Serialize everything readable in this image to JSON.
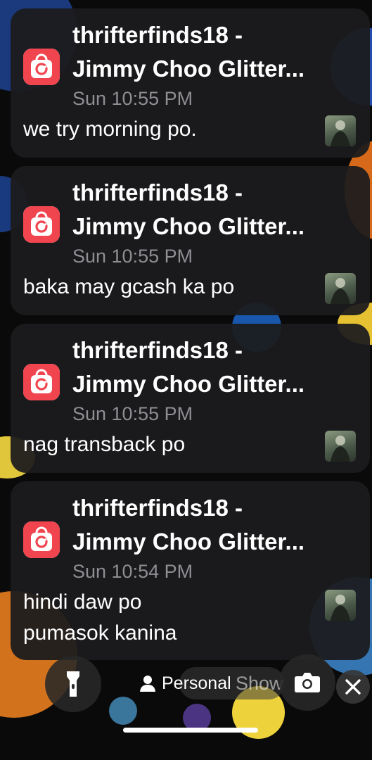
{
  "notifications": [
    {
      "title_line1": "thrifterfinds18 -",
      "title_line2": "Jimmy Choo Glitter...",
      "time": "Sun 10:55 PM",
      "message_line1": "we try morning po.",
      "message_line2": ""
    },
    {
      "title_line1": "thrifterfinds18 -",
      "title_line2": "Jimmy Choo Glitter...",
      "time": "Sun 10:55 PM",
      "message_line1": "baka may gcash ka po",
      "message_line2": ""
    },
    {
      "title_line1": "thrifterfinds18 -",
      "title_line2": "Jimmy Choo Glitter...",
      "time": "Sun 10:55 PM",
      "message_line1": "nag transback po",
      "message_line2": ""
    },
    {
      "title_line1": "thrifterfinds18 -",
      "title_line2": "Jimmy Choo Glitter...",
      "time": "Sun 10:54 PM",
      "message_line1": "hindi daw po",
      "message_line2": "pumasok kanina"
    }
  ],
  "lockscreen": {
    "focus_label": "Personal",
    "show_label": "Show",
    "flashlight_icon": "flashlight-icon",
    "camera_icon": "camera-icon",
    "close_icon": "close-icon",
    "focus_icon": "person-icon"
  },
  "colors": {
    "app_icon_red": "#f0454f",
    "card_bg": "#1c1c1e",
    "time_gray": "#8e8e93"
  }
}
